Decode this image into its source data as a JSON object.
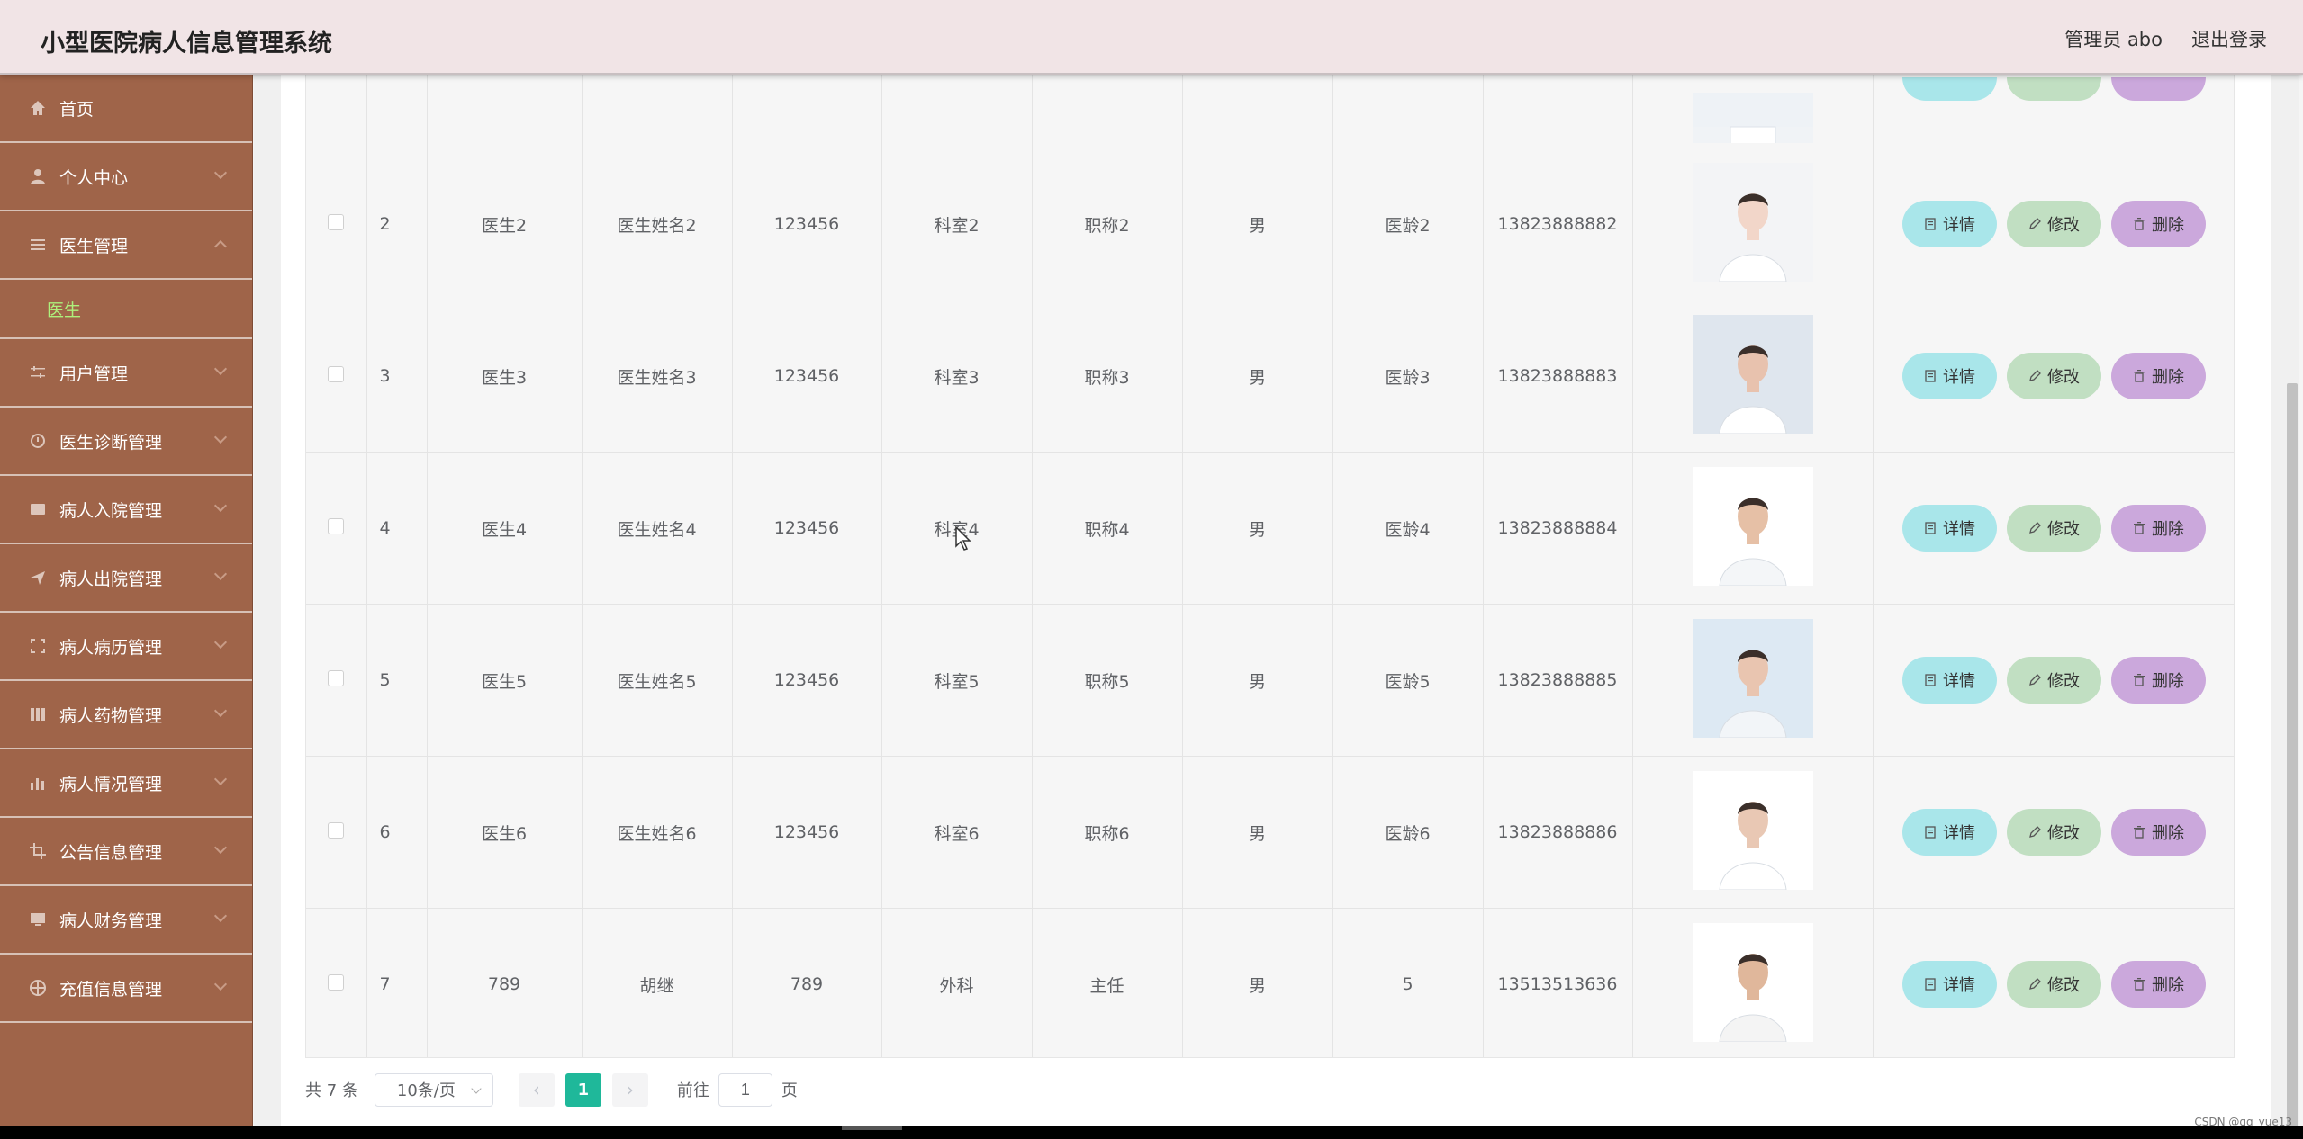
{
  "header": {
    "title": "小型医院病人信息管理系统",
    "user_label": "管理员 abo",
    "logout_label": "退出登录"
  },
  "sidebar": {
    "items": [
      {
        "label": "首页",
        "icon": "home-icon"
      },
      {
        "label": "个人中心",
        "icon": "user-icon"
      },
      {
        "label": "医生管理",
        "icon": "list-icon",
        "expanded": true,
        "sub": "医生"
      },
      {
        "label": "用户管理",
        "icon": "sliders-icon"
      },
      {
        "label": "医生诊断管理",
        "icon": "gauge-icon"
      },
      {
        "label": "病人入院管理",
        "icon": "card-icon"
      },
      {
        "label": "病人出院管理",
        "icon": "send-icon"
      },
      {
        "label": "病人病历管理",
        "icon": "frame-icon"
      },
      {
        "label": "病人药物管理",
        "icon": "bars-icon"
      },
      {
        "label": "病人情况管理",
        "icon": "chart-icon"
      },
      {
        "label": "公告信息管理",
        "icon": "crop-icon"
      },
      {
        "label": "病人财务管理",
        "icon": "monitor-icon"
      },
      {
        "label": "充值信息管理",
        "icon": "globe-icon"
      }
    ],
    "sub_label": "医生"
  },
  "table": {
    "rows": [
      {
        "index": "2",
        "account": "医生2",
        "name": "医生姓名2",
        "password": "123456",
        "dept": "科室2",
        "title": "职称2",
        "gender": "男",
        "years": "医龄2",
        "phone": "13823888882"
      },
      {
        "index": "3",
        "account": "医生3",
        "name": "医生姓名3",
        "password": "123456",
        "dept": "科室3",
        "title": "职称3",
        "gender": "男",
        "years": "医龄3",
        "phone": "13823888883"
      },
      {
        "index": "4",
        "account": "医生4",
        "name": "医生姓名4",
        "password": "123456",
        "dept": "科室4",
        "title": "职称4",
        "gender": "男",
        "years": "医龄4",
        "phone": "13823888884"
      },
      {
        "index": "5",
        "account": "医生5",
        "name": "医生姓名5",
        "password": "123456",
        "dept": "科室5",
        "title": "职称5",
        "gender": "男",
        "years": "医龄5",
        "phone": "13823888885"
      },
      {
        "index": "6",
        "account": "医生6",
        "name": "医生姓名6",
        "password": "123456",
        "dept": "科室6",
        "title": "职称6",
        "gender": "男",
        "years": "医龄6",
        "phone": "13823888886"
      },
      {
        "index": "7",
        "account": "789",
        "name": "胡继",
        "password": "789",
        "dept": "外科",
        "title": "主任",
        "gender": "男",
        "years": "5",
        "phone": "13513513636"
      }
    ],
    "actions": {
      "detail": "详情",
      "edit": "修改",
      "delete": "删除"
    }
  },
  "pagination": {
    "total": "共 7 条",
    "page_size": "10条/页",
    "current_page": "1",
    "goto_label": "前往",
    "goto_value": "1",
    "page_suffix": "页"
  },
  "watermark": "CSDN @qq_yue13",
  "colors": {
    "header_bg": "#f1e4e6",
    "sidebar_bg": "#9f6449",
    "active_sub": "#aef07c",
    "pager_active": "#1fb89a",
    "btn_detail": "#a9e6ea",
    "btn_edit": "#c1dfc2",
    "btn_delete": "#cba8dc"
  }
}
